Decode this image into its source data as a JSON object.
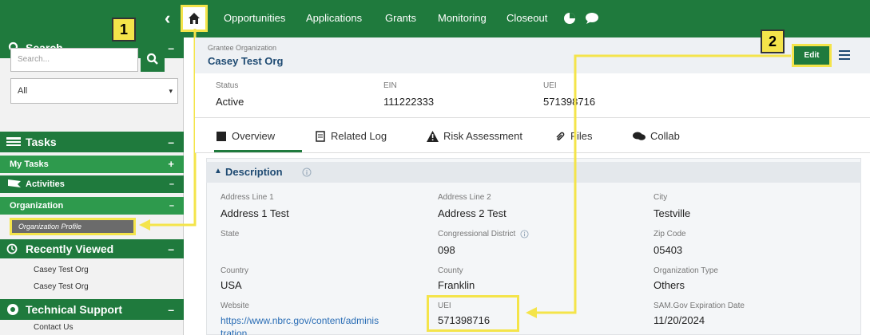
{
  "nav": {
    "items": [
      "Opportunities",
      "Applications",
      "Grants",
      "Monitoring",
      "Closeout"
    ]
  },
  "callouts": {
    "one": "1",
    "two": "2"
  },
  "sidebar": {
    "search_title": "Search",
    "search_placeholder": "Search...",
    "filter_value": "All",
    "tasks": "Tasks",
    "my_tasks": "My Tasks",
    "activities": "Activities",
    "organization": "Organization",
    "organization_profile": "Organization Profile",
    "recently_viewed": "Recently Viewed",
    "recent": [
      "Casey Test Org",
      "Casey Test Org"
    ],
    "technical_support": "Technical Support",
    "contact_us": "Contact Us"
  },
  "org": {
    "type_label": "Grantee Organization",
    "name": "Casey Test Org",
    "edit_label": "Edit"
  },
  "summary": {
    "status_label": "Status",
    "status": "Active",
    "ein_label": "EIN",
    "ein": "111222333",
    "uei_label": "UEI",
    "uei": "571398716"
  },
  "tabs": [
    "Overview",
    "Related Log",
    "Risk Assessment",
    "Files",
    "Collab"
  ],
  "description": {
    "title": "Description",
    "fields": [
      {
        "label": "Address Line 1",
        "value": "Address 1 Test"
      },
      {
        "label": "Address Line 2",
        "value": "Address 2 Test"
      },
      {
        "label": "City",
        "value": "Testville"
      },
      {
        "label": "State",
        "value": ""
      },
      {
        "label": "Congressional District",
        "value": "098"
      },
      {
        "label": "Zip Code",
        "value": "05403"
      },
      {
        "label": "Country",
        "value": "USA"
      },
      {
        "label": "County",
        "value": "Franklin"
      },
      {
        "label": "Organization Type",
        "value": "Others"
      },
      {
        "label": "Website",
        "value": "https://www.nbrc.gov/content/adminis tration"
      },
      {
        "label": "UEI",
        "value": "571398716"
      },
      {
        "label": "SAM.Gov Expiration Date",
        "value": "11/20/2024"
      }
    ]
  },
  "colors": {
    "brand_green": "#1f7a3d",
    "callout_yellow": "#f4e44a"
  }
}
